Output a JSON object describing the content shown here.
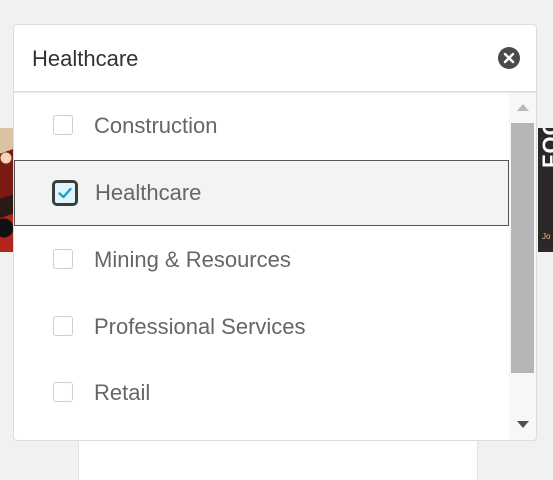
{
  "select": {
    "value": "Healthcare",
    "clear_icon": "clear-circle-x-icon"
  },
  "dropdown": {
    "options": [
      {
        "label": "Construction",
        "checked": false
      },
      {
        "label": "Healthcare",
        "checked": true
      },
      {
        "label": "Mining & Resources",
        "checked": false
      },
      {
        "label": "Professional Services",
        "checked": false
      },
      {
        "label": "Retail",
        "checked": false
      }
    ]
  },
  "background": {
    "right_banner_text": "FOOD",
    "right_banner_sub": "Jo"
  },
  "colors": {
    "check_accent": "#1aa3c6",
    "selected_row_bg": "#f2f3f5"
  }
}
